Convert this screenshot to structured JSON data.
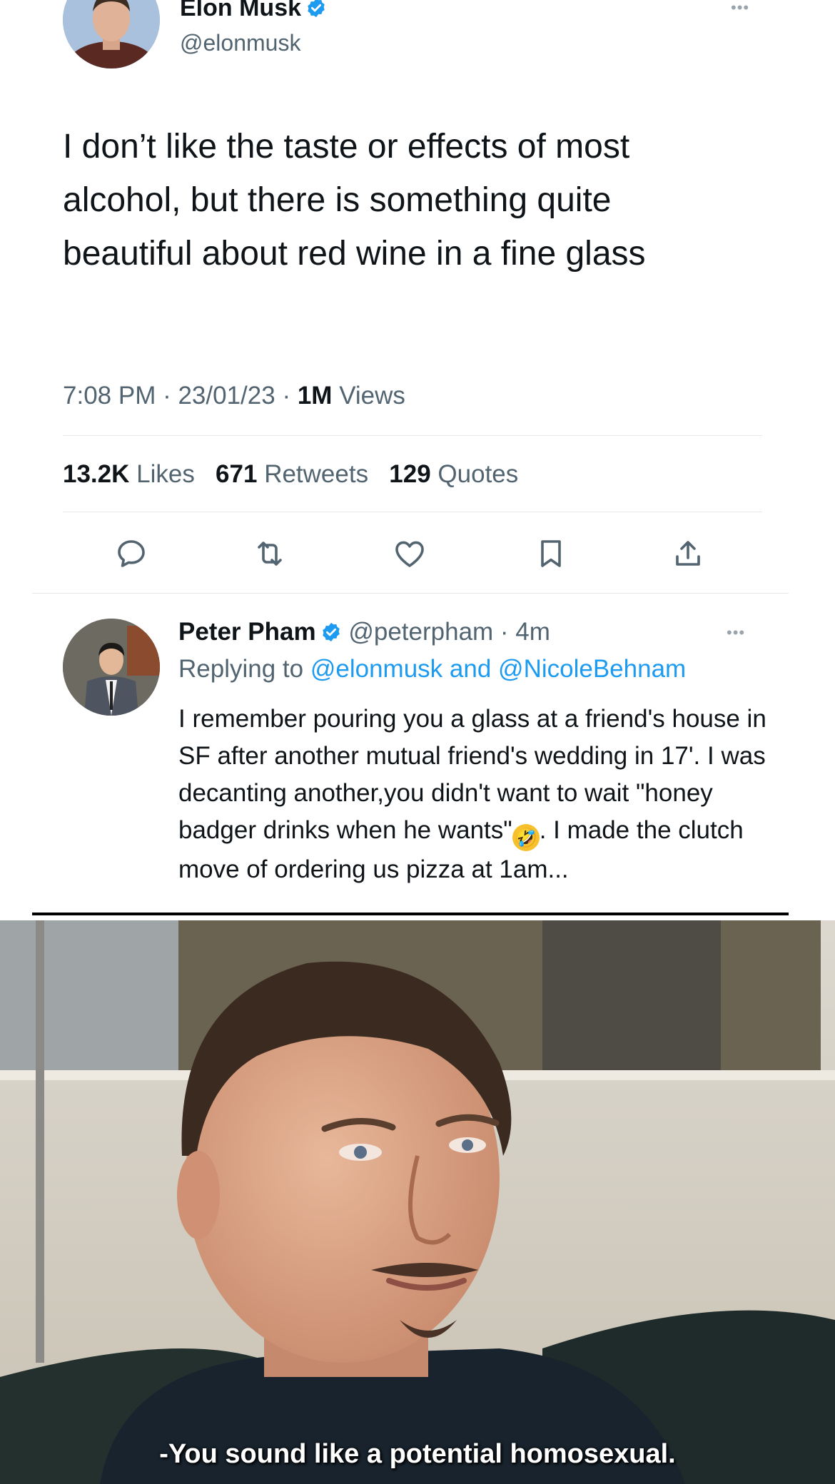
{
  "tweet": {
    "author_name": "Elon Musk",
    "author_handle": "@elonmusk",
    "text": "I don’t like the taste or effects of most alcohol, but there is something quite beautiful about red wine in a fine glass",
    "time": "7:08 PM",
    "date": "23/01/23",
    "views_count": "1M",
    "views_label": "Views",
    "likes_count": "13.2K",
    "likes_label": "Likes",
    "retweets_count": "671",
    "retweets_label": "Retweets",
    "quotes_count": "129",
    "quotes_label": "Quotes",
    "more_label": "•••",
    "icons": [
      "reply-icon",
      "retweet-icon",
      "like-icon",
      "bookmark-icon",
      "share-icon"
    ]
  },
  "reply": {
    "author_name": "Peter Pham",
    "author_handle": "@peterpham",
    "age": "4m",
    "replying_prefix": "Replying to",
    "mention_1": "@elonmusk",
    "conjunction": "and",
    "mention_2": "@NicoleBehnam",
    "text_before_emoji": "I remember pouring you a glass at a friend's house in SF after another mutual friend's wedding in 17'.  I was decanting another,you didn't want to wait \"honey badger drinks when he wants\"",
    "text_after_emoji": ". I made the clutch move of ordering us pizza at 1am...",
    "more_label": "•••"
  },
  "meme": {
    "caption": "-You sound like a potential homosexual."
  },
  "colors": {
    "verified_blue": "#1d9bf0",
    "secondary_text": "#536471",
    "primary_text": "#0f1419"
  }
}
